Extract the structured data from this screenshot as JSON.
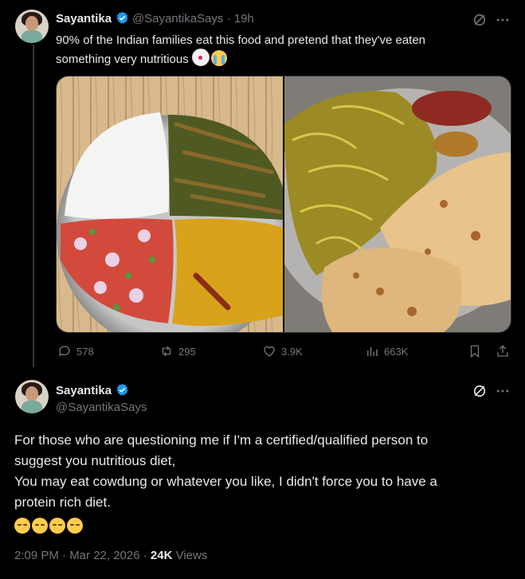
{
  "tweet1": {
    "name": "Sayantika",
    "handle_time": "@SayantikaSays · 19h",
    "text_line1": "90% of the Indian families eat this food and pretend that they've eaten",
    "text_line2": "something very nutritious",
    "emojis": [
      "clown-face-emoji",
      "loudly-crying-emoji"
    ],
    "stats": {
      "replies": "578",
      "retweets": "295",
      "likes": "3.9K",
      "views": "663K"
    }
  },
  "tweet2": {
    "name": "Sayantika",
    "handle": "@SayantikaSays",
    "paragraph1_line1": "For those who are questioning me if I'm a certified/qualified person to",
    "paragraph1_line2": "suggest you nutritious diet,",
    "paragraph2_line1": "You may eat cowdung or whatever you like, I didn't force you to have a",
    "paragraph2_line2": "protein rich diet.",
    "emojis": [
      "sleepy-face-emoji",
      "sleepy-face-emoji",
      "sleepy-face-emoji",
      "sleepy-face-emoji"
    ],
    "timestamp": "2:09 PM · Mar 22, 2026 · ",
    "views_count": "24K",
    "views_label": " Views"
  },
  "colors": {
    "background": "#000000",
    "text": "#e7e9ea",
    "muted": "#71767b",
    "verified": "#1d9bf0",
    "divider": "#2f3336"
  }
}
